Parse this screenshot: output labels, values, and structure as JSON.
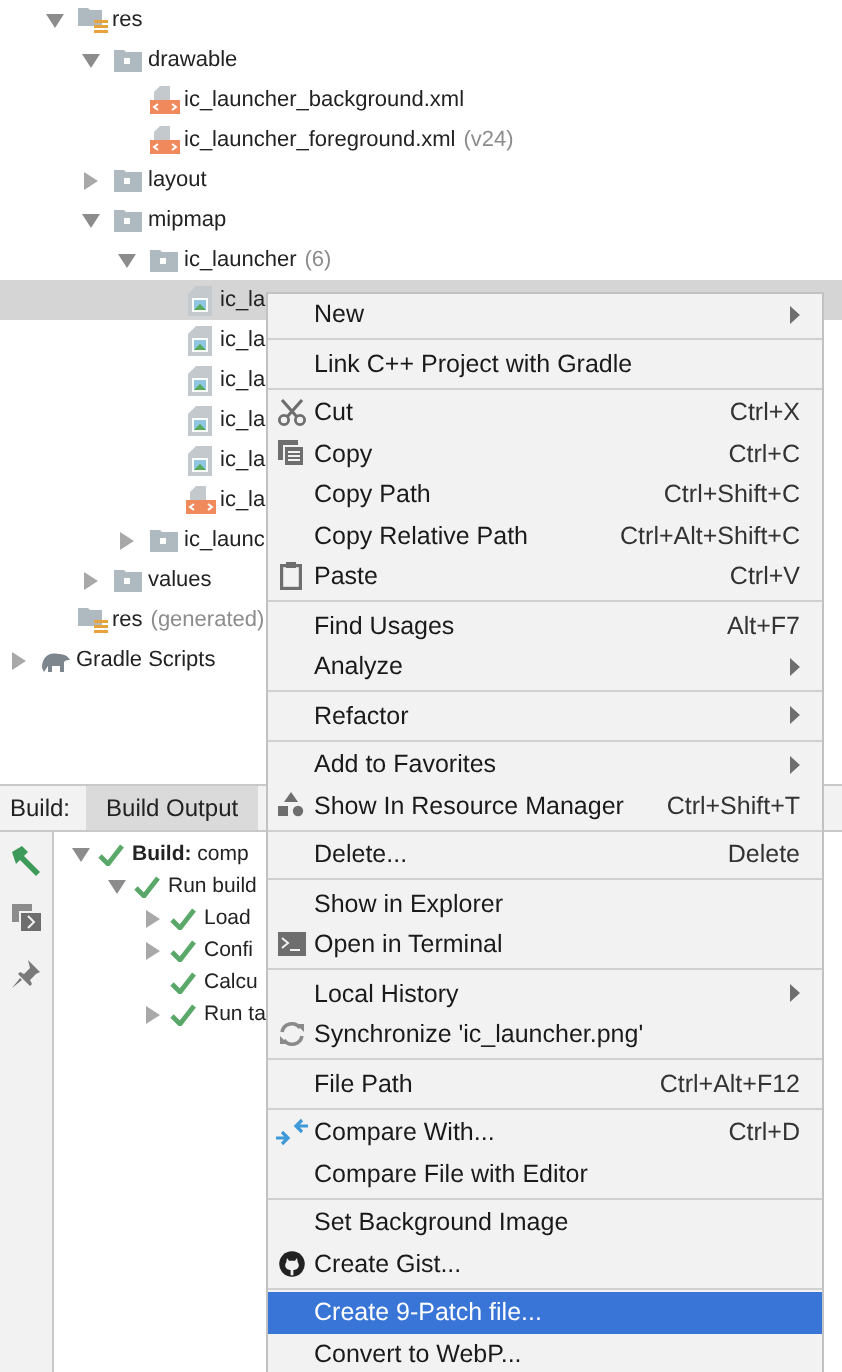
{
  "project_tree": [
    {
      "children": [
        {
          "label": "res",
          "kind": "res-folder",
          "expanded": true,
          "selected": false,
          "children": [
            {
              "label": "drawable",
              "kind": "folder",
              "expanded": true,
              "selected": false,
              "children": [
                {
                  "label": "ic_launcher_background.xml",
                  "kind": "xml",
                  "selected": false
                },
                {
                  "label": "ic_launcher_foreground.xml",
                  "note": "(v24)",
                  "kind": "xml",
                  "selected": false
                }
              ]
            },
            {
              "label": "layout",
              "kind": "folder",
              "expanded": false,
              "selected": false
            },
            {
              "label": "mipmap",
              "kind": "folder",
              "expanded": true,
              "selected": false,
              "children": [
                {
                  "label": "ic_launcher",
                  "note": "(6)",
                  "kind": "folder",
                  "expanded": true,
                  "selected": false,
                  "children": [
                    {
                      "label": "ic_la",
                      "kind": "image",
                      "selected": true
                    },
                    {
                      "label": "ic_la",
                      "kind": "image",
                      "selected": false
                    },
                    {
                      "label": "ic_la",
                      "kind": "image",
                      "selected": false
                    },
                    {
                      "label": "ic_la",
                      "kind": "image",
                      "selected": false
                    },
                    {
                      "label": "ic_la",
                      "kind": "image",
                      "selected": false
                    },
                    {
                      "label": "ic_la",
                      "kind": "xml",
                      "selected": false
                    }
                  ]
                },
                {
                  "label": "ic_launc",
                  "kind": "folder",
                  "expanded": false,
                  "selected": false
                }
              ]
            },
            {
              "label": "values",
              "kind": "folder",
              "expanded": false,
              "selected": false
            }
          ]
        },
        {
          "label": "res",
          "note": "(generated)",
          "kind": "res-folder",
          "selected": false
        }
      ]
    },
    {
      "label": "Gradle Scripts",
      "kind": "gradle",
      "expanded": false,
      "selected": false
    }
  ],
  "build_panel": {
    "title": "Build:",
    "tabs": [
      {
        "label": "Build Output",
        "selected": true
      }
    ],
    "tree": [
      {
        "label": "**Build:** comp",
        "expanded": true,
        "children": [
          {
            "label": "Run build",
            "expanded": true,
            "children": [
              {
                "label": "Load",
                "expanded": false
              },
              {
                "label": "Confi",
                "expanded": false
              },
              {
                "label": "Calcu"
              },
              {
                "label": "Run ta",
                "expanded": false
              }
            ]
          }
        ]
      }
    ]
  },
  "context_menu": [
    {
      "kind": "item",
      "label": "New",
      "submenu": true,
      "selected": false
    },
    {
      "kind": "separator"
    },
    {
      "kind": "item",
      "label": "Link C++ Project with Gradle",
      "selected": false
    },
    {
      "kind": "separator"
    },
    {
      "kind": "cut",
      "label": "Cut",
      "shortcut": "Ctrl+X",
      "selected": false
    },
    {
      "kind": "copy",
      "label": "Copy",
      "shortcut": "Ctrl+C",
      "selected": false
    },
    {
      "kind": "item",
      "label": "Copy Path",
      "shortcut": "Ctrl+Shift+C",
      "selected": false
    },
    {
      "kind": "item",
      "label": "Copy Relative Path",
      "shortcut": "Ctrl+Alt+Shift+C",
      "selected": false
    },
    {
      "kind": "paste",
      "label": "Paste",
      "shortcut": "Ctrl+V",
      "selected": false
    },
    {
      "kind": "separator"
    },
    {
      "kind": "item",
      "label": "Find Usages",
      "shortcut": "Alt+F7",
      "selected": false
    },
    {
      "kind": "item",
      "label": "Analyze",
      "submenu": true,
      "selected": false
    },
    {
      "kind": "separator"
    },
    {
      "kind": "item",
      "label": "Refactor",
      "submenu": true,
      "selected": false
    },
    {
      "kind": "separator"
    },
    {
      "kind": "item",
      "label": "Add to Favorites",
      "submenu": true,
      "selected": false
    },
    {
      "kind": "resources",
      "label": "Show In Resource Manager",
      "shortcut": "Ctrl+Shift+T",
      "selected": false
    },
    {
      "kind": "separator"
    },
    {
      "kind": "item",
      "label": "Delete...",
      "shortcut": "Delete",
      "selected": false
    },
    {
      "kind": "separator"
    },
    {
      "kind": "item",
      "label": "Show in Explorer",
      "selected": false
    },
    {
      "kind": "terminal",
      "label": "Open in Terminal",
      "selected": false
    },
    {
      "kind": "separator"
    },
    {
      "kind": "item",
      "label": "Local History",
      "submenu": true,
      "selected": false
    },
    {
      "kind": "sync",
      "label": "Synchronize 'ic_launcher.png'",
      "selected": false
    },
    {
      "kind": "separator"
    },
    {
      "kind": "item",
      "label": "File Path",
      "shortcut": "Ctrl+Alt+F12",
      "selected": false
    },
    {
      "kind": "separator"
    },
    {
      "kind": "compare",
      "label": "Compare With...",
      "shortcut": "Ctrl+D",
      "selected": false
    },
    {
      "kind": "item",
      "label": "Compare File with Editor",
      "selected": false
    },
    {
      "kind": "separator"
    },
    {
      "kind": "item",
      "label": "Set Background Image",
      "selected": false
    },
    {
      "kind": "gist",
      "label": "Create Gist...",
      "selected": false
    },
    {
      "kind": "separator"
    },
    {
      "kind": "item",
      "label": "Create 9-Patch file...",
      "selected": true
    },
    {
      "kind": "item",
      "label": "Convert to WebP...",
      "selected": false
    }
  ]
}
